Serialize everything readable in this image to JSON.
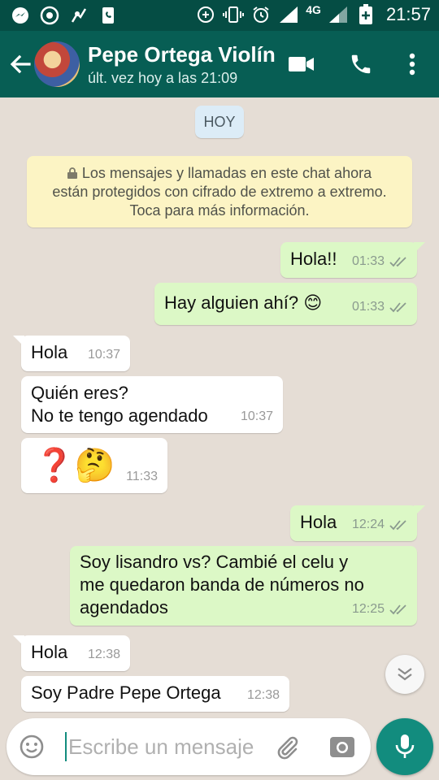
{
  "status_bar": {
    "network": "4G",
    "time": "21:57",
    "left_icons": [
      "messenger-icon",
      "chrome-icon",
      "app-icon",
      "phone-app-icon"
    ],
    "right_icons": [
      "data-saver-icon",
      "vibrate-icon",
      "alarm-icon",
      "signal-icon",
      "battery-icon"
    ]
  },
  "header": {
    "contact_name": "Pepe Ortega Violín",
    "last_seen": "últ. vez hoy a las 21:09",
    "icons": [
      "back-arrow-icon",
      "video-call-icon",
      "phone-icon",
      "more-vert-icon"
    ]
  },
  "colors": {
    "header": "#075e54",
    "status_bar": "#054d44",
    "chat_bg": "#e5ddd5",
    "outgoing_bubble": "#dcf8c6",
    "incoming_bubble": "#ffffff",
    "accent": "#128c7e",
    "read_tick": "#8a9a8e"
  },
  "chat": {
    "date_chip": "HOY",
    "encryption_notice": {
      "line1": "Los mensajes y llamadas en este chat ahora",
      "line2": "están protegidos con cifrado de extremo a extremo.",
      "line3": "Toca para más información."
    },
    "messages": [
      {
        "dir": "out",
        "text": "Hola!!",
        "time": "01:33",
        "status": "delivered"
      },
      {
        "dir": "out",
        "text": "Hay alguien ahí? 😊",
        "time": "01:33",
        "status": "delivered"
      },
      {
        "dir": "in",
        "text": "Hola",
        "time": "10:37"
      },
      {
        "dir": "in",
        "text": "Quién eres?\nNo te tengo agendado",
        "time": "10:37"
      },
      {
        "dir": "in",
        "text": "❓🤔",
        "time": "11:33"
      },
      {
        "dir": "out",
        "text": "Hola",
        "time": "12:24",
        "status": "delivered"
      },
      {
        "dir": "out",
        "text": "Soy lisandro vs? Cambié el celu y\nme quedaron banda de números no\nagendados",
        "time": "12:25",
        "status": "delivered"
      },
      {
        "dir": "in",
        "text": "Hola",
        "time": "12:38"
      },
      {
        "dir": "in",
        "text": "Soy Padre Pepe Ortega",
        "time": "12:38"
      }
    ]
  },
  "composer": {
    "placeholder": "Escribe un mensaje",
    "icons": [
      "emoji-icon",
      "attach-icon",
      "camera-icon",
      "mic-icon"
    ]
  }
}
